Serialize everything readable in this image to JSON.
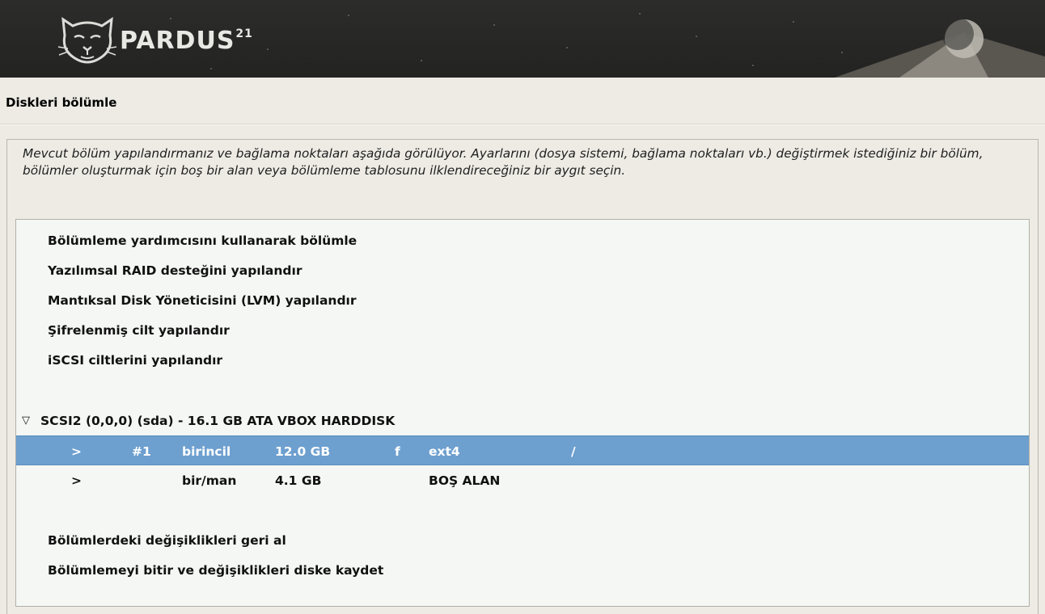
{
  "header": {
    "logo_text": "PARDUS",
    "logo_version": "21"
  },
  "page": {
    "title": "Diskleri bölümle",
    "description": "Mevcut bölüm yapılandırmanız ve bağlama noktaları aşağıda görülüyor. Ayarlarını (dosya sistemi, bağlama noktaları vb.) değiştirmek istediğiniz bir bölüm, bölümler oluşturmak için boş bir alan veya bölümleme tablosunu ilklendireceğiniz bir aygıt seçin."
  },
  "menu": {
    "guided": "Bölümleme yardımcısını kullanarak bölümle",
    "raid": "Yazılımsal RAID desteğini yapılandır",
    "lvm": "Mantıksal Disk Yöneticisini (LVM) yapılandır",
    "encrypted": "Şifrelenmiş cilt yapılandır",
    "iscsi": "iSCSI ciltlerini yapılandır"
  },
  "disk": {
    "expander": "▽",
    "label": "SCSI2 (0,0,0) (sda) - 16.1 GB ATA VBOX HARDDISK",
    "partitions": [
      {
        "arrow": ">",
        "number": "#1",
        "type": "birincil",
        "size": "12.0 GB",
        "flag": "f",
        "fs": "ext4",
        "mount": "/"
      },
      {
        "arrow": ">",
        "number": "",
        "type": "bir/man",
        "size": "4.1 GB",
        "flag": "",
        "fs": "BOŞ ALAN",
        "mount": ""
      }
    ]
  },
  "actions": {
    "undo": "Bölümlerdeki değişiklikleri geri al",
    "finish": "Bölümlemeyi bitir ve değişiklikleri diske kaydet"
  },
  "colors": {
    "selection": "#6d9fcf",
    "banner": "#262625",
    "background": "#edebe4"
  }
}
